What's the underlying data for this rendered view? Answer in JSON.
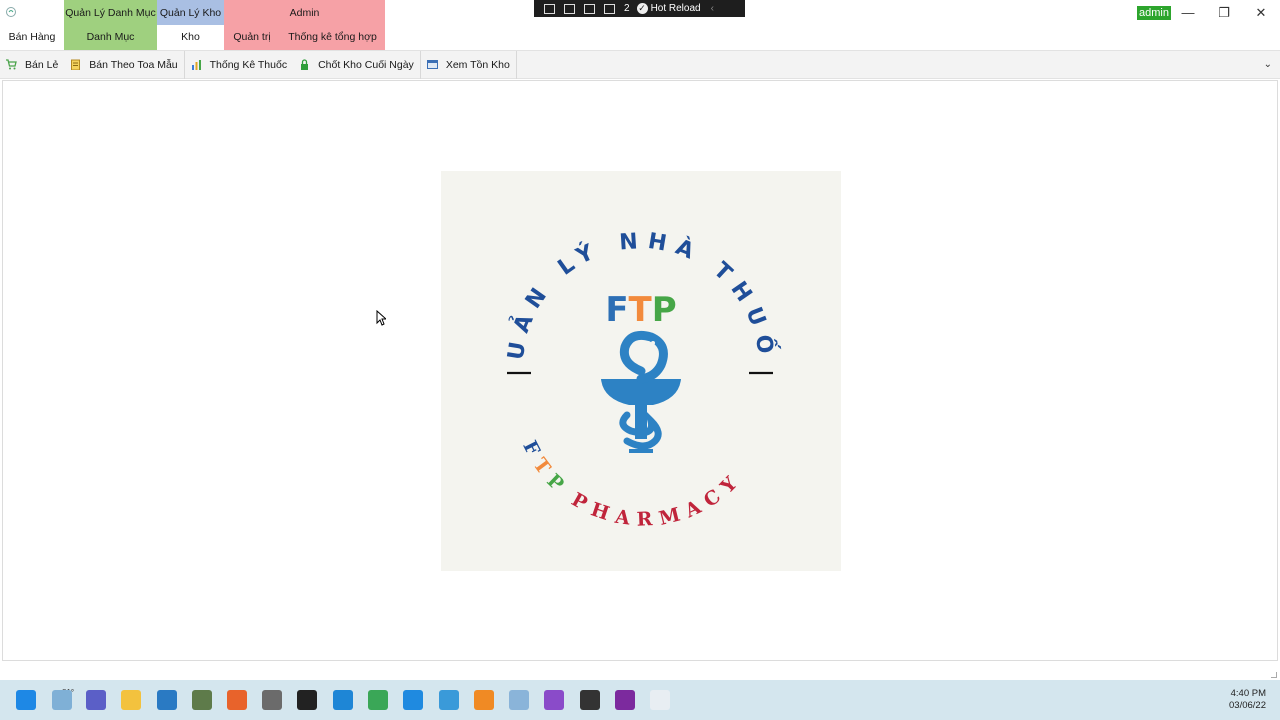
{
  "ribbon": {
    "groups": [
      {
        "key": "banhang",
        "header": "",
        "tabs": [
          "Bán Hàng"
        ]
      },
      {
        "key": "danhmuc",
        "header": "Quản Lý Danh Mục",
        "tabs": [
          "Danh Mục"
        ]
      },
      {
        "key": "kho",
        "header": "Quản Lý Kho",
        "tabs": [
          "Kho"
        ]
      },
      {
        "key": "admin",
        "header": "Admin",
        "tabs": [
          "Quản trị",
          "Thống kê tổng hợp"
        ]
      }
    ]
  },
  "debugbar": {
    "error_count": "2",
    "hot_reload": "Hot Reload"
  },
  "window": {
    "user": "admin",
    "minimize": "—",
    "restore": "❐",
    "close": "✕"
  },
  "commands": [
    {
      "label": "Bán Lẻ",
      "icon": "cart-icon",
      "color": "#4aa34a"
    },
    {
      "label": "Bán Theo Toa Mẫu",
      "icon": "clipboard-icon",
      "color": "#d4a534"
    },
    {
      "label": "Thống Kê Thuốc",
      "icon": "bar-chart-icon",
      "color": "#3b7dd8"
    },
    {
      "label": "Chốt Kho Cuối Ngày",
      "icon": "lock-icon",
      "color": "#2e9e3a"
    },
    {
      "label": "Xem Tồn Kho",
      "icon": "inventory-icon",
      "color": "#3b6fb5"
    }
  ],
  "logo": {
    "arc_top": "QUẢN LÝ NHÀ THUỐC",
    "brand": [
      "F",
      "T",
      "P"
    ],
    "arc_bottom_brand": "FTP",
    "arc_bottom_rest": "PHARMACY",
    "colors": {
      "f": "#2d6fb5",
      "t": "#f28a3c",
      "p": "#46a647",
      "navy": "#1f4e99",
      "red": "#c0243b",
      "snake": "#2d82c4"
    }
  },
  "taskbar": {
    "temperature": "81°",
    "time": "4:40 PM",
    "date": "03/06/22",
    "apps": [
      {
        "name": "start-icon",
        "color": "#1e88e5"
      },
      {
        "name": "weather-icon",
        "color": "#7fb0d6"
      },
      {
        "name": "chat-icon",
        "color": "#5b5fc7"
      },
      {
        "name": "file-explorer-icon",
        "color": "#f3c23e"
      },
      {
        "name": "vscode-icon",
        "color": "#2a7ac3"
      },
      {
        "name": "people-app-icon",
        "color": "#5e7b4a"
      },
      {
        "name": "firefox-icon",
        "color": "#e8632b"
      },
      {
        "name": "calculator-icon",
        "color": "#6b6b6b"
      },
      {
        "name": "sticky-notes-icon",
        "color": "#222222"
      },
      {
        "name": "edge-icon",
        "color": "#1e86d6"
      },
      {
        "name": "chrome-icon",
        "color": "#3aa757"
      },
      {
        "name": "zalo-icon",
        "color": "#1f8ae0"
      },
      {
        "name": "snipping-icon",
        "color": "#3a9ad9"
      },
      {
        "name": "vlc-icon",
        "color": "#f08a24"
      },
      {
        "name": "photos-icon",
        "color": "#8ab4d9"
      },
      {
        "name": "visual-studio-icon",
        "color": "#8a4bc9"
      },
      {
        "name": "obs-icon",
        "color": "#333333"
      },
      {
        "name": "onenote-icon",
        "color": "#7c2a9e"
      },
      {
        "name": "pharmacy-app-icon",
        "color": "#e8eef2"
      }
    ]
  }
}
